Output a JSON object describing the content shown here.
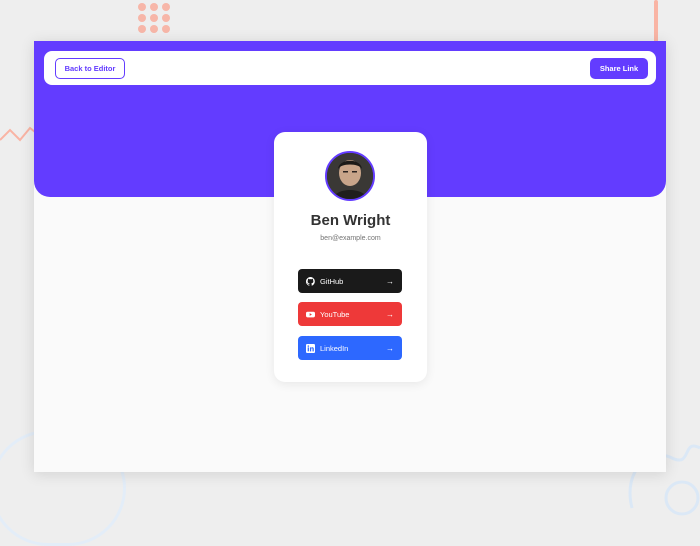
{
  "nav": {
    "back_label": "Back to Editor",
    "share_label": "Share Link"
  },
  "profile": {
    "name": "Ben Wright",
    "email": "ben@example.com"
  },
  "links": [
    {
      "platform": "GitHub",
      "color": "#1a1a1a",
      "icon": "github-icon"
    },
    {
      "platform": "YouTube",
      "color": "#ee3939",
      "icon": "youtube-icon"
    },
    {
      "platform": "LinkedIn",
      "color": "#2d68ff",
      "icon": "linkedin-icon"
    }
  ],
  "colors": {
    "accent": "#633cff",
    "background": "#fafafa"
  }
}
